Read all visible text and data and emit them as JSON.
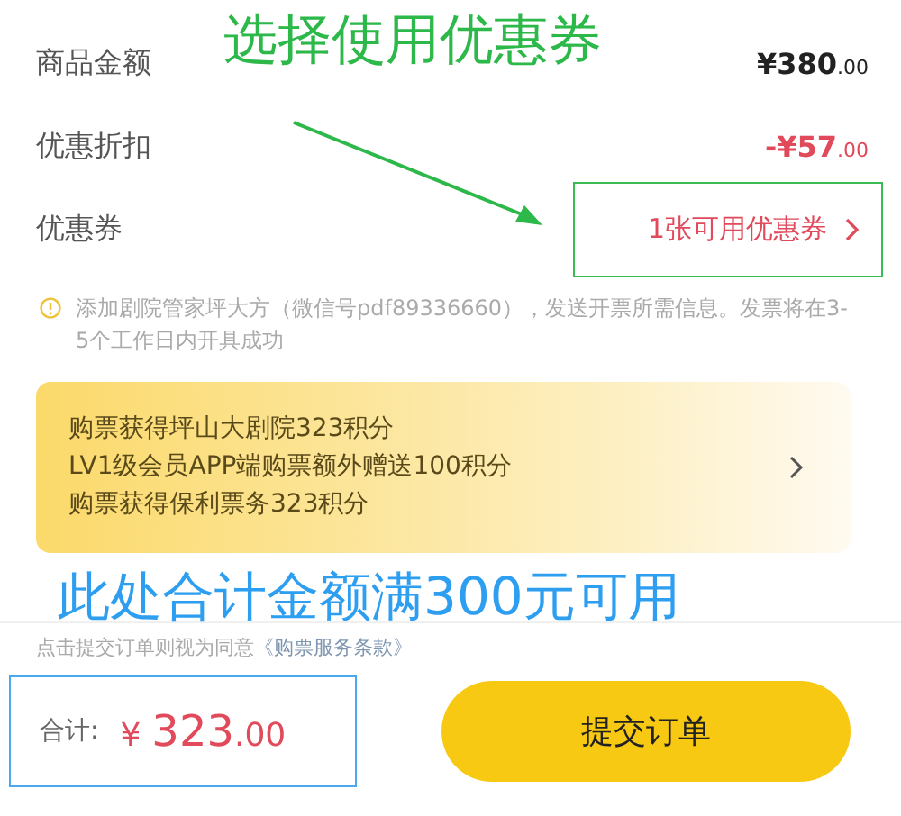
{
  "annotations": {
    "heading": "选择使用优惠券",
    "note": "此处合计金额满300元可用"
  },
  "price_rows": [
    {
      "kind": "amount",
      "label": "商品金额",
      "main": "¥380",
      "cents": ".00"
    },
    {
      "kind": "discount",
      "label": "优惠折扣",
      "main": "-¥57",
      "cents": ".00"
    },
    {
      "kind": "coupon",
      "label": "优惠券",
      "value": "1张可用优惠券"
    }
  ],
  "notice": "添加剧院管家坪大方（微信号pdf89336660），发送开票所需信息。发票将在3-5个工作日内开具成功",
  "points_card": {
    "lines": [
      "购票获得坪山大剧院323积分",
      "LV1级会员APP端购票额外赠送100积分",
      "购票获得保利票务323积分"
    ]
  },
  "terms": {
    "text": "点击提交订单则视为同意",
    "link": "《购票服务条款》"
  },
  "footer": {
    "total_label": "合计:",
    "currency": "¥",
    "total_main": "323",
    "total_cents": ".00",
    "submit": "提交订单"
  }
}
